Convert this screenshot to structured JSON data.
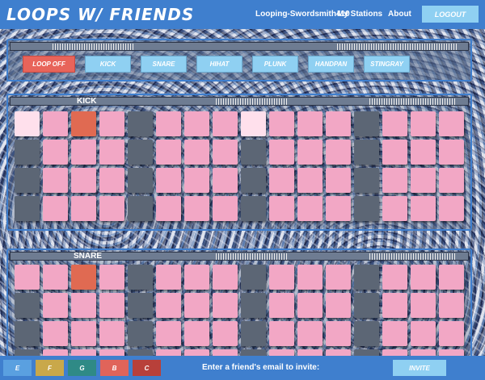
{
  "app": {
    "logo": "Loops W/ Friends",
    "nav": {
      "username": "Looping-Swordsmith410",
      "stations": "My Stations",
      "about": "About",
      "logout": "LOGOUT"
    }
  },
  "instruments": {
    "loop_off": "LOOP OFF",
    "buttons": [
      "KICK",
      "SNARE",
      "HIHAT",
      "PLUNK",
      "HANDPAN",
      "STINGRAY"
    ]
  },
  "tracks": [
    {
      "label": "KICK",
      "rows": [
        [
          "light",
          "pink",
          "hit",
          "pink",
          "beat",
          "pink",
          "pink",
          "pink",
          "light",
          "pink",
          "pink",
          "pink",
          "beat",
          "pink",
          "pink",
          "pink"
        ],
        [
          "beat",
          "pink",
          "pink",
          "pink",
          "beat",
          "pink",
          "pink",
          "pink",
          "beat",
          "pink",
          "pink",
          "pink",
          "beat",
          "pink",
          "pink",
          "pink"
        ],
        [
          "beat",
          "pink",
          "pink",
          "pink",
          "beat",
          "pink",
          "pink",
          "pink",
          "beat",
          "pink",
          "pink",
          "pink",
          "beat",
          "pink",
          "pink",
          "pink"
        ],
        [
          "beat",
          "pink",
          "pink",
          "pink",
          "beat",
          "pink",
          "pink",
          "pink",
          "beat",
          "pink",
          "pink",
          "pink",
          "beat",
          "pink",
          "pink",
          "pink"
        ]
      ]
    },
    {
      "label": "SNARE",
      "rows": [
        [
          "pink",
          "pink",
          "hit",
          "pink",
          "beat",
          "pink",
          "pink",
          "pink",
          "beat",
          "pink",
          "pink",
          "pink",
          "beat",
          "pink",
          "pink",
          "pink"
        ],
        [
          "beat",
          "pink",
          "pink",
          "pink",
          "beat",
          "pink",
          "pink",
          "pink",
          "beat",
          "pink",
          "pink",
          "pink",
          "beat",
          "pink",
          "pink",
          "pink"
        ],
        [
          "beat",
          "pink",
          "pink",
          "pink",
          "beat",
          "pink",
          "pink",
          "pink",
          "beat",
          "pink",
          "pink",
          "pink",
          "beat",
          "pink",
          "pink",
          "pink"
        ],
        [
          "beat",
          "pink",
          "pink",
          "pink",
          "beat",
          "pink",
          "pink",
          "pink",
          "beat",
          "pink",
          "pink",
          "pink",
          "beat",
          "pink",
          "pink",
          "pink"
        ]
      ]
    }
  ],
  "keys": [
    {
      "label": "E",
      "color": "#5aa0e0"
    },
    {
      "label": "F",
      "color": "#c9a84a"
    },
    {
      "label": "G",
      "color": "#2f8a86"
    },
    {
      "label": "B",
      "color": "#e0645a"
    },
    {
      "label": "C",
      "color": "#b8403a"
    }
  ],
  "invite": {
    "label": "Enter a friend's email to invite:",
    "button": "INVITE"
  }
}
